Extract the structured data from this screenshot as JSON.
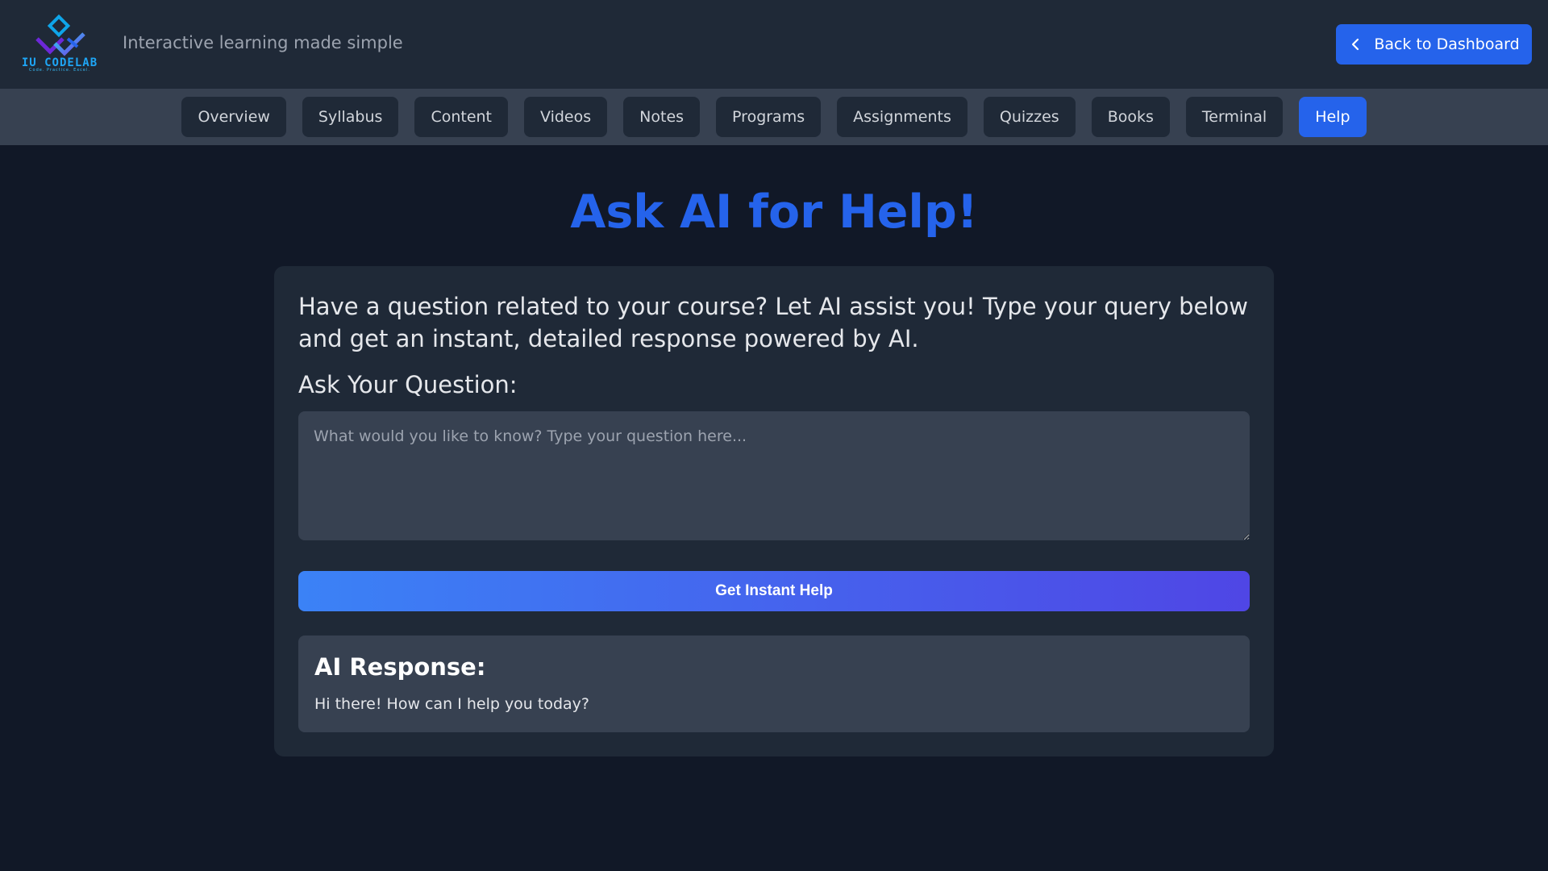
{
  "header": {
    "logo_text": "IU CODELAB",
    "logo_subtext": "Code. Practice. Excel.",
    "tagline": "Interactive learning made simple",
    "back_button_label": "Back to Dashboard"
  },
  "nav": {
    "items": [
      {
        "label": "Overview"
      },
      {
        "label": "Syllabus"
      },
      {
        "label": "Content"
      },
      {
        "label": "Videos"
      },
      {
        "label": "Notes"
      },
      {
        "label": "Programs"
      },
      {
        "label": "Assignments"
      },
      {
        "label": "Quizzes"
      },
      {
        "label": "Books"
      },
      {
        "label": "Terminal"
      },
      {
        "label": "Help"
      }
    ],
    "active": "Help"
  },
  "main": {
    "title": "Ask AI for Help!",
    "intro": "Have a question related to your course? Let AI assist you! Type your query below and get an instant, detailed response powered by AI.",
    "question_label": "Ask Your Question:",
    "question_placeholder": "What would you like to know? Type your question here...",
    "question_value": "",
    "submit_label": "Get Instant Help",
    "response_title": "AI Response:",
    "response_text": "Hi there! How can I help you today?"
  },
  "colors": {
    "accent": "#2563eb",
    "background": "#111827",
    "surface": "#1f2937",
    "field": "#374151",
    "gradient_start": "#3b82f6",
    "gradient_end": "#4f46e5"
  },
  "icons": {
    "logo": "iu-codelab-logo-icon",
    "back": "chevron-left-icon"
  }
}
